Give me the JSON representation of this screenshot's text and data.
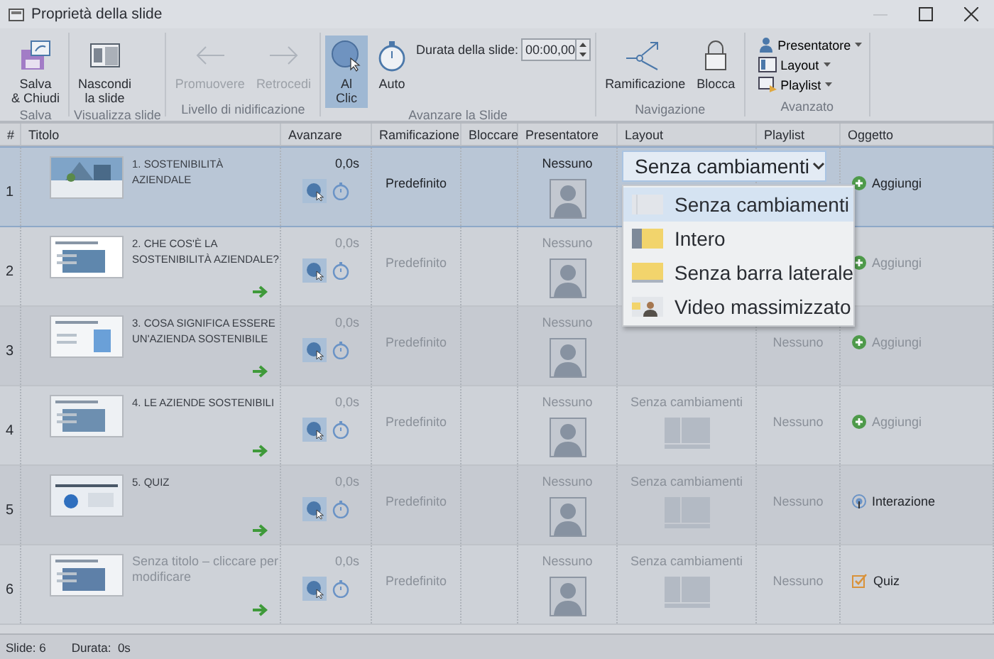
{
  "window": {
    "title": "Proprietà della slide"
  },
  "ribbon": {
    "groups": [
      {
        "label": "Salva",
        "items": [
          {
            "kind": "save",
            "label": "Salva\n& Chiudi",
            "disabled": false,
            "selected": false
          }
        ]
      },
      {
        "label": "Visualizza slide",
        "items": [
          {
            "kind": "hide",
            "label": "Nascondi\nla slide",
            "disabled": false,
            "selected": false
          }
        ]
      },
      {
        "label": "Livello di nidificazione",
        "items": [
          {
            "kind": "left",
            "label": "Promuovere",
            "disabled": true,
            "selected": false
          },
          {
            "kind": "right",
            "label": "Retrocedi",
            "disabled": true,
            "selected": false
          }
        ]
      },
      {
        "label": "Avanzare la Slide",
        "items": [
          {
            "kind": "click",
            "label": "Al\nClic",
            "disabled": false,
            "selected": true
          },
          {
            "kind": "timer",
            "label": "Auto",
            "disabled": false,
            "selected": false
          },
          {
            "kind": "duration",
            "label": "Durata della slide:",
            "value": "00:00,00"
          }
        ]
      },
      {
        "label": "Navigazione",
        "items": [
          {
            "kind": "branch",
            "label": "Ramificazione",
            "disabled": false,
            "selected": false
          },
          {
            "kind": "lock",
            "label": "Blocca",
            "disabled": false,
            "selected": false
          }
        ]
      },
      {
        "label": "Avanzato",
        "items": [
          {
            "kind": "menus",
            "entries": [
              {
                "kind": "person",
                "label": "Presentatore"
              },
              {
                "kind": "layout",
                "label": "Layout"
              },
              {
                "kind": "playlist",
                "label": "Playlist"
              }
            ]
          }
        ]
      }
    ]
  },
  "table": {
    "columns": [
      "#",
      "Titolo",
      "Avanzare",
      "Ramificazione",
      "Bloccare",
      "Presentatore",
      "Layout",
      "Playlist",
      "Oggetto"
    ],
    "rows": [
      {
        "number": "1",
        "title": "1. SOSTENIBILITÀ AZIENDALE",
        "untitled": false,
        "selected": true,
        "arrow": false,
        "advance": "0,0s",
        "on_click": true,
        "branching": "Predefinito",
        "presenter": "Nessuno",
        "layout_dropdown": {
          "value": "Senza cambiamenti",
          "expanded": true,
          "options": [
            {
              "kind": "none",
              "label": "Senza cambiamenti",
              "selected": true
            },
            {
              "kind": "full",
              "label": "Intero",
              "selected": false
            },
            {
              "kind": "nosidebar",
              "label": "Senza barra laterale",
              "selected": false
            },
            {
              "kind": "video",
              "label": "Video massimizzato",
              "selected": false
            }
          ]
        },
        "object": {
          "kind": "add",
          "label": "Aggiungi"
        }
      },
      {
        "number": "2",
        "title": "2. CHE COS'È LA SOSTENIBILITÀ AZIENDALE?",
        "untitled": false,
        "selected": false,
        "arrow": true,
        "advance": "0,0s",
        "on_click": true,
        "branching": "Predefinito",
        "presenter": "Nessuno",
        "object": {
          "kind": "add",
          "label": "Aggiungi"
        }
      },
      {
        "number": "3",
        "title": "3. COSA SIGNIFICA ESSERE UN'AZIENDA SOSTENIBILE",
        "untitled": false,
        "selected": false,
        "arrow": true,
        "advance": "0,0s",
        "on_click": true,
        "branching": "Predefinito",
        "presenter": "Nessuno",
        "playlist": "Nessuno",
        "object": {
          "kind": "add",
          "label": "Aggiungi"
        }
      },
      {
        "number": "4",
        "title": "4. LE AZIENDE SOSTENIBILI",
        "untitled": false,
        "selected": false,
        "arrow": true,
        "advance": "0,0s",
        "on_click": true,
        "branching": "Predefinito",
        "presenter": "Nessuno",
        "layout": "Senza cambiamenti",
        "playlist": "Nessuno",
        "object": {
          "kind": "add",
          "label": "Aggiungi"
        }
      },
      {
        "number": "5",
        "title": "5. QUIZ",
        "untitled": false,
        "selected": false,
        "arrow": true,
        "advance": "0,0s",
        "on_click": true,
        "branching": "Predefinito",
        "presenter": "Nessuno",
        "layout": "Senza cambiamenti",
        "playlist": "Nessuno",
        "object": {
          "kind": "interaction",
          "label": "Interazione"
        }
      },
      {
        "number": "6",
        "title": "Senza titolo – cliccare per modificare",
        "untitled": true,
        "selected": false,
        "arrow": true,
        "advance": "0,0s",
        "on_click": true,
        "branching": "Predefinito",
        "presenter": "Nessuno",
        "layout": "Senza cambiamenti",
        "playlist": "Nessuno",
        "object": {
          "kind": "quiz",
          "label": "Quiz"
        }
      }
    ]
  },
  "status_bar": [
    "Slide: 6",
    "Durata:  0s"
  ]
}
